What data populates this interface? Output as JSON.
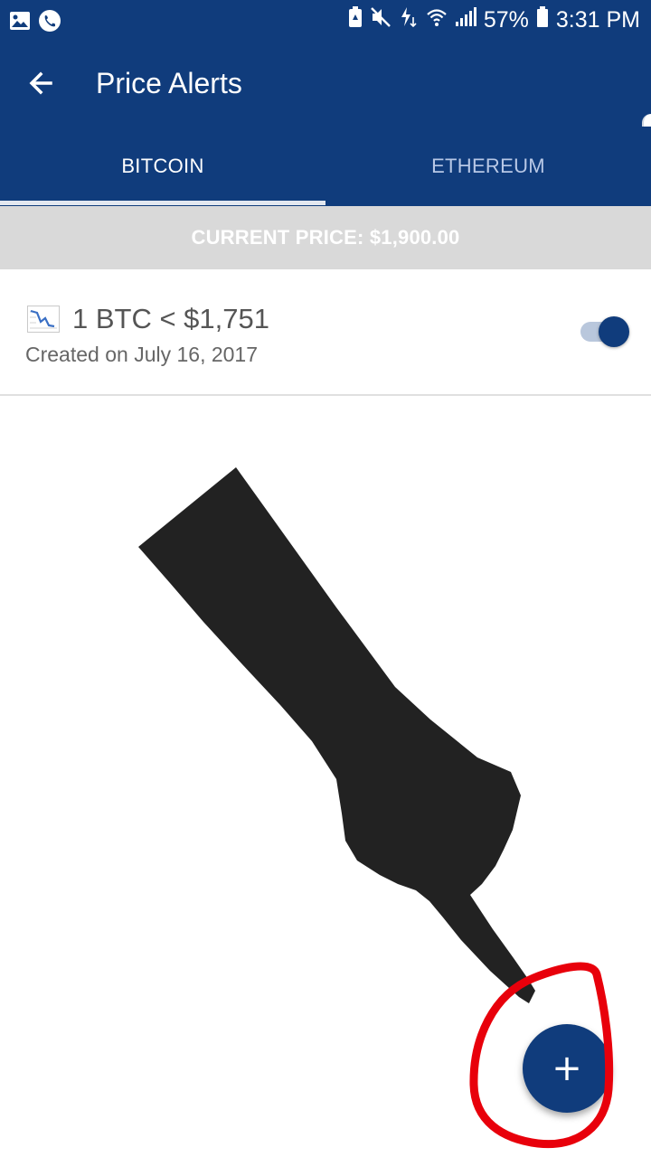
{
  "status_bar": {
    "left_icons": [
      "gallery-icon",
      "phone-call-icon"
    ],
    "right_icons": [
      "battery-saver-icon",
      "mute-icon",
      "data-transfer-icon",
      "wifi-icon",
      "signal-icon",
      "battery-icon"
    ],
    "battery": "57%",
    "time": "3:31 PM"
  },
  "app_bar": {
    "back_icon": "arrow-left-icon",
    "title": "Price Alerts"
  },
  "tabs": [
    {
      "label": "BITCOIN",
      "selected": true
    },
    {
      "label": "ETHEREUM",
      "selected": false
    }
  ],
  "banner": {
    "current_price": "CURRENT PRICE: $1,900.00"
  },
  "alerts": [
    {
      "trend_icon": "chart-decreasing-icon",
      "condition": "1 BTC < $1,751",
      "created": "Created on July 16, 2017",
      "enabled": true
    }
  ],
  "fab": {
    "icon": "plus-icon",
    "label": "+"
  },
  "colors": {
    "primary": "#103c7c",
    "banner_bg": "#d9d9d9",
    "annotation_red": "#e8000b",
    "hand": "#222222"
  }
}
